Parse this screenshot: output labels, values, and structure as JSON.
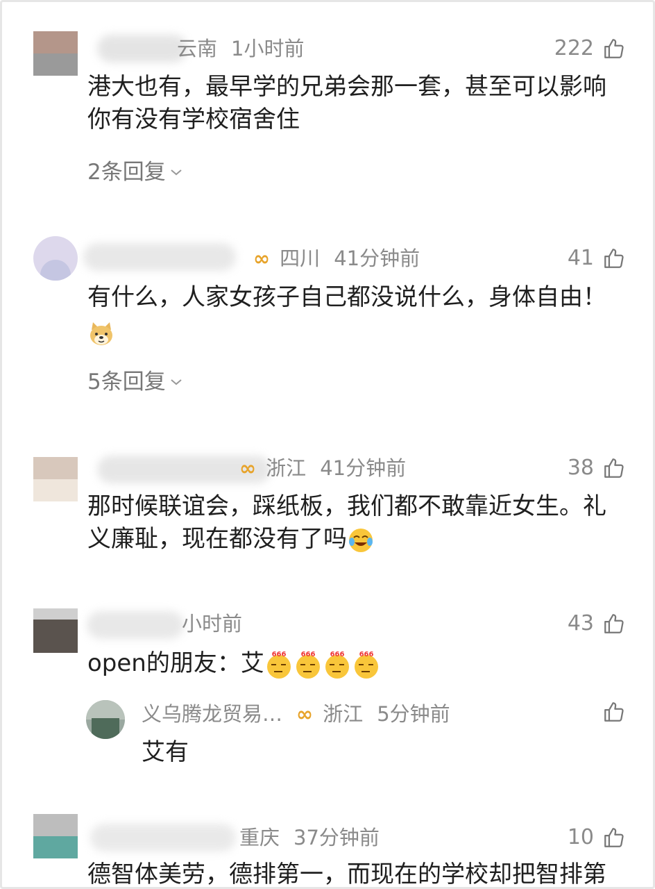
{
  "comments": [
    {
      "name_tail": "云南",
      "location": "",
      "time": "1小时前",
      "likes": "222",
      "text_lines": [
        "港大也有，最早学的兄弟会那一套，甚至可以影响",
        "你有没有学校宿舍住"
      ],
      "replies_label": "2条回复"
    },
    {
      "name_tail": "",
      "location": "四川",
      "time": "41分钟前",
      "likes": "41",
      "text_lines": [
        "有什么，人家女孩子自己都没说什么，身体自由！"
      ],
      "emoji": "doge",
      "replies_label": "5条回复"
    },
    {
      "name_tail": "",
      "location": "浙江",
      "time": "41分钟前",
      "likes": "38",
      "text_lines": [
        "那时候联谊会，踩纸板，我们都不敢靠近女生。礼",
        "义廉耻，现在都没有了吗"
      ],
      "emoji": "laugh-cry"
    },
    {
      "name_tail": "",
      "location": "",
      "time": "小时前",
      "likes": "43",
      "text": "open的朋友：艾",
      "emoji": "666-thinking",
      "reply": {
        "name": "义乌腾龙贸易…",
        "location": "浙江",
        "time": "5分钟前",
        "text": "艾有"
      }
    },
    {
      "name_tail": "",
      "location": "重庆",
      "time": "37分钟前",
      "likes": "10",
      "text_lines": [
        "德智体美劳，德排第一，而现在的学校却把智排第"
      ]
    }
  ],
  "colors": {
    "meta": "#8a8a8a",
    "badge": "#e7a32a",
    "text": "#1f1f1f"
  }
}
